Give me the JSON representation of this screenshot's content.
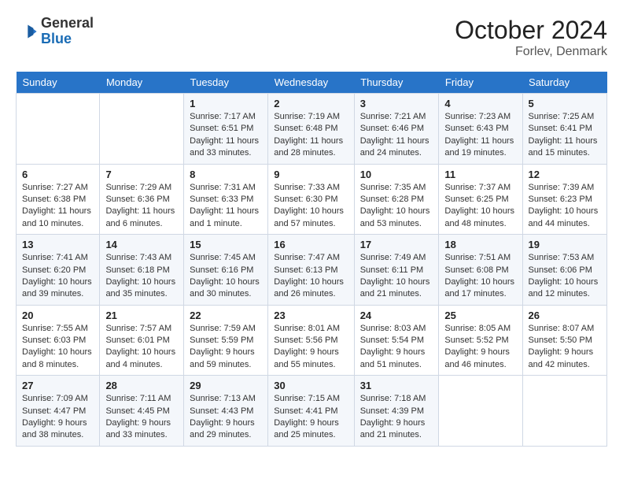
{
  "header": {
    "logo_text_general": "General",
    "logo_text_blue": "Blue",
    "main_title": "October 2024",
    "sub_title": "Forlev, Denmark"
  },
  "weekdays": [
    "Sunday",
    "Monday",
    "Tuesday",
    "Wednesday",
    "Thursday",
    "Friday",
    "Saturday"
  ],
  "weeks": [
    [
      {
        "day": "",
        "info": ""
      },
      {
        "day": "",
        "info": ""
      },
      {
        "day": "1",
        "info": "Sunrise: 7:17 AM\nSunset: 6:51 PM\nDaylight: 11 hours and 33 minutes."
      },
      {
        "day": "2",
        "info": "Sunrise: 7:19 AM\nSunset: 6:48 PM\nDaylight: 11 hours and 28 minutes."
      },
      {
        "day": "3",
        "info": "Sunrise: 7:21 AM\nSunset: 6:46 PM\nDaylight: 11 hours and 24 minutes."
      },
      {
        "day": "4",
        "info": "Sunrise: 7:23 AM\nSunset: 6:43 PM\nDaylight: 11 hours and 19 minutes."
      },
      {
        "day": "5",
        "info": "Sunrise: 7:25 AM\nSunset: 6:41 PM\nDaylight: 11 hours and 15 minutes."
      }
    ],
    [
      {
        "day": "6",
        "info": "Sunrise: 7:27 AM\nSunset: 6:38 PM\nDaylight: 11 hours and 10 minutes."
      },
      {
        "day": "7",
        "info": "Sunrise: 7:29 AM\nSunset: 6:36 PM\nDaylight: 11 hours and 6 minutes."
      },
      {
        "day": "8",
        "info": "Sunrise: 7:31 AM\nSunset: 6:33 PM\nDaylight: 11 hours and 1 minute."
      },
      {
        "day": "9",
        "info": "Sunrise: 7:33 AM\nSunset: 6:30 PM\nDaylight: 10 hours and 57 minutes."
      },
      {
        "day": "10",
        "info": "Sunrise: 7:35 AM\nSunset: 6:28 PM\nDaylight: 10 hours and 53 minutes."
      },
      {
        "day": "11",
        "info": "Sunrise: 7:37 AM\nSunset: 6:25 PM\nDaylight: 10 hours and 48 minutes."
      },
      {
        "day": "12",
        "info": "Sunrise: 7:39 AM\nSunset: 6:23 PM\nDaylight: 10 hours and 44 minutes."
      }
    ],
    [
      {
        "day": "13",
        "info": "Sunrise: 7:41 AM\nSunset: 6:20 PM\nDaylight: 10 hours and 39 minutes."
      },
      {
        "day": "14",
        "info": "Sunrise: 7:43 AM\nSunset: 6:18 PM\nDaylight: 10 hours and 35 minutes."
      },
      {
        "day": "15",
        "info": "Sunrise: 7:45 AM\nSunset: 6:16 PM\nDaylight: 10 hours and 30 minutes."
      },
      {
        "day": "16",
        "info": "Sunrise: 7:47 AM\nSunset: 6:13 PM\nDaylight: 10 hours and 26 minutes."
      },
      {
        "day": "17",
        "info": "Sunrise: 7:49 AM\nSunset: 6:11 PM\nDaylight: 10 hours and 21 minutes."
      },
      {
        "day": "18",
        "info": "Sunrise: 7:51 AM\nSunset: 6:08 PM\nDaylight: 10 hours and 17 minutes."
      },
      {
        "day": "19",
        "info": "Sunrise: 7:53 AM\nSunset: 6:06 PM\nDaylight: 10 hours and 12 minutes."
      }
    ],
    [
      {
        "day": "20",
        "info": "Sunrise: 7:55 AM\nSunset: 6:03 PM\nDaylight: 10 hours and 8 minutes."
      },
      {
        "day": "21",
        "info": "Sunrise: 7:57 AM\nSunset: 6:01 PM\nDaylight: 10 hours and 4 minutes."
      },
      {
        "day": "22",
        "info": "Sunrise: 7:59 AM\nSunset: 5:59 PM\nDaylight: 9 hours and 59 minutes."
      },
      {
        "day": "23",
        "info": "Sunrise: 8:01 AM\nSunset: 5:56 PM\nDaylight: 9 hours and 55 minutes."
      },
      {
        "day": "24",
        "info": "Sunrise: 8:03 AM\nSunset: 5:54 PM\nDaylight: 9 hours and 51 minutes."
      },
      {
        "day": "25",
        "info": "Sunrise: 8:05 AM\nSunset: 5:52 PM\nDaylight: 9 hours and 46 minutes."
      },
      {
        "day": "26",
        "info": "Sunrise: 8:07 AM\nSunset: 5:50 PM\nDaylight: 9 hours and 42 minutes."
      }
    ],
    [
      {
        "day": "27",
        "info": "Sunrise: 7:09 AM\nSunset: 4:47 PM\nDaylight: 9 hours and 38 minutes."
      },
      {
        "day": "28",
        "info": "Sunrise: 7:11 AM\nSunset: 4:45 PM\nDaylight: 9 hours and 33 minutes."
      },
      {
        "day": "29",
        "info": "Sunrise: 7:13 AM\nSunset: 4:43 PM\nDaylight: 9 hours and 29 minutes."
      },
      {
        "day": "30",
        "info": "Sunrise: 7:15 AM\nSunset: 4:41 PM\nDaylight: 9 hours and 25 minutes."
      },
      {
        "day": "31",
        "info": "Sunrise: 7:18 AM\nSunset: 4:39 PM\nDaylight: 9 hours and 21 minutes."
      },
      {
        "day": "",
        "info": ""
      },
      {
        "day": "",
        "info": ""
      }
    ]
  ]
}
